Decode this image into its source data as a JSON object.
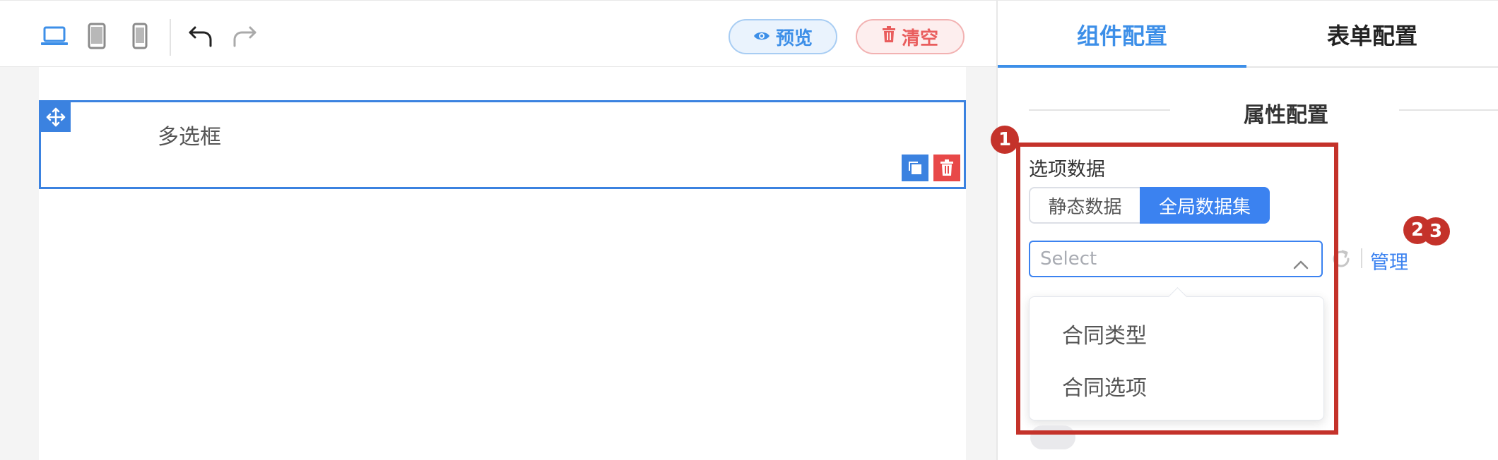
{
  "toolbar": {
    "devices": [
      {
        "icon": "laptop-icon",
        "active": true
      },
      {
        "icon": "tablet-icon",
        "active": false
      },
      {
        "icon": "phone-icon",
        "active": false
      }
    ],
    "undo_icon": "undo-icon",
    "redo_icon": "redo-icon",
    "preview_label": "预览",
    "clear_label": "清空"
  },
  "canvas": {
    "field_label": "多选框"
  },
  "panel": {
    "tabs": [
      {
        "label": "组件配置",
        "active": true
      },
      {
        "label": "表单配置",
        "active": false
      }
    ],
    "section_title": "属性配置",
    "options_label": "选项数据",
    "segments": [
      "静态数据",
      "全局数据集"
    ],
    "selected_segment": "全局数据集",
    "select_placeholder": "Select",
    "manage_link": "管理",
    "dropdown_items": [
      "合同类型",
      "合同选项"
    ]
  },
  "annotations": [
    "1",
    "2",
    "3"
  ],
  "colors": {
    "accent": "#3b82f0",
    "danger": "#e84848",
    "highlight": "#c4322a"
  }
}
